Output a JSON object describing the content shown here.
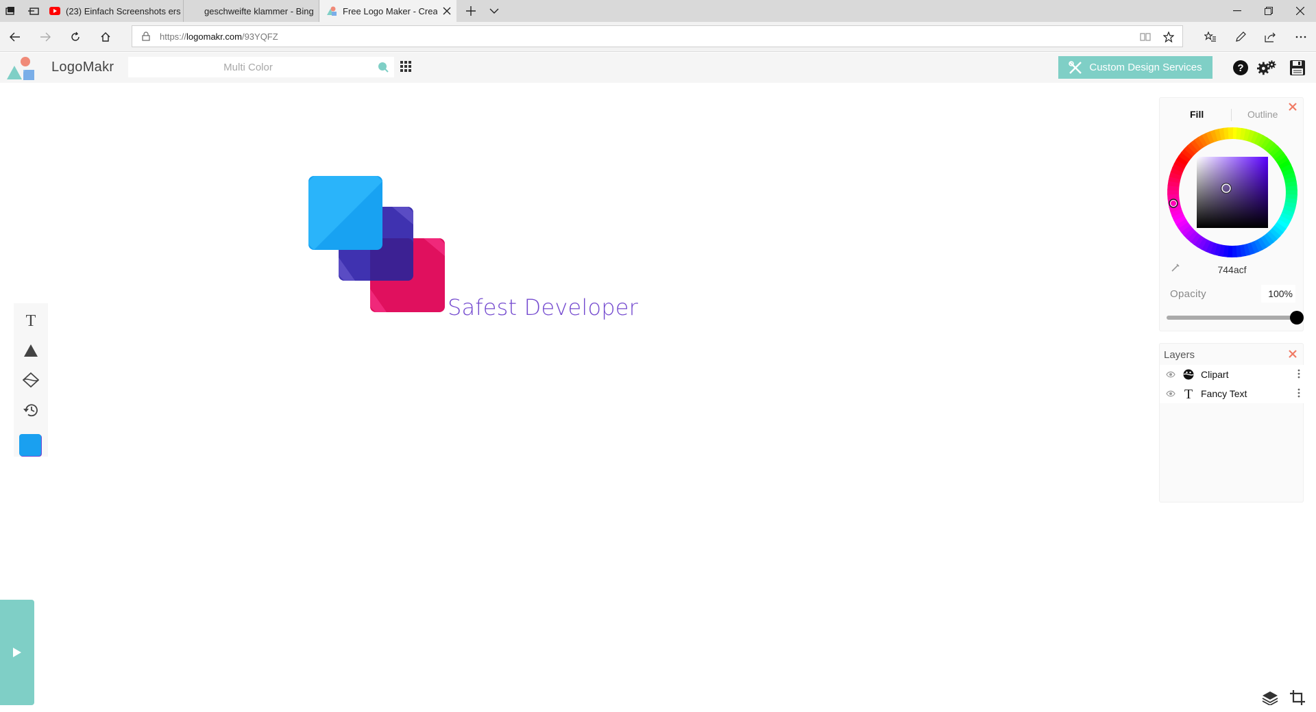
{
  "browser": {
    "tabs": [
      {
        "label": "(23) Einfach Screenshots ers",
        "icon": "youtube-icon",
        "active": false
      },
      {
        "label": "geschweifte klammer - Bing",
        "icon": "bing-icon",
        "active": false
      },
      {
        "label": "Free Logo Maker - Crea",
        "icon": "logomakr-favicon",
        "active": true
      }
    ],
    "url_protocol": "https://",
    "url_host": "logomakr.com",
    "url_path": "/93YQFZ"
  },
  "app": {
    "brand": "LogoMakr",
    "search_placeholder": "Multi Color",
    "custom_design_label": "Custom Design Services",
    "accent_color": "#7fcfc6"
  },
  "canvas": {
    "logo_text": "Safest Developer",
    "text_color": "#744acf",
    "shape_colors": [
      "#1aa0f0",
      "#3f32b0",
      "#e0105e"
    ]
  },
  "color_panel": {
    "tab_fill": "Fill",
    "tab_outline": "Outline",
    "hex": "744acf",
    "opacity_label": "Opacity",
    "opacity_value": "100%",
    "opacity_fraction": 1.0
  },
  "layers": {
    "title": "Layers",
    "items": [
      {
        "name": "Clipart",
        "icon": "clipart-icon"
      },
      {
        "name": "Fancy Text",
        "icon": "text-icon"
      }
    ]
  }
}
